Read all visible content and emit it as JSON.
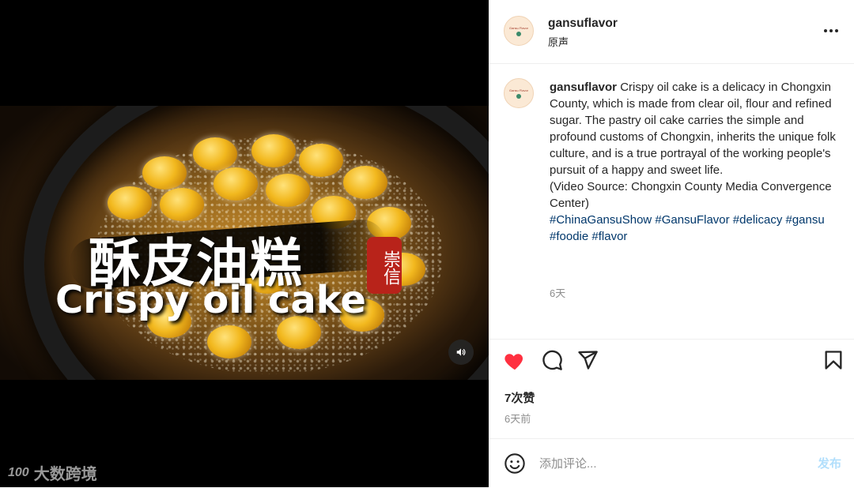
{
  "video": {
    "title_cn": "酥皮油糕",
    "seal_text": "崇信",
    "title_en": "Crispy oil cake",
    "audio_icon": "speaker-icon"
  },
  "watermark": {
    "text": "大数跨境",
    "logo_text": "100"
  },
  "header": {
    "username": "gansuflavor",
    "audio_label": "原声",
    "avatar_text": "Gansu Flavor",
    "more_icon": "more-dots-icon"
  },
  "caption": {
    "username": "gansuflavor",
    "text": "Crispy oil cake is a delicacy in Chongxin County, which is made from clear oil, flour and refined sugar. The pastry oil cake carries the simple and profound customs of Chongxin, inherits the unique folk culture, and is a true portrayal of the working people's pursuit of a happy and sweet life.\n(Video Source: Chongxin County Media Convergence Center)",
    "hashtags": "#ChinaGansuShow #GansuFlavor #delicacy #gansu #foodie #flavor",
    "time_ago": "6天"
  },
  "actions": {
    "like_icon": "heart-filled-icon",
    "comment_icon": "comment-icon",
    "share_icon": "send-icon",
    "save_icon": "bookmark-icon",
    "like_color": "#ff3040"
  },
  "likes": {
    "label": "7次赞"
  },
  "posted": {
    "label": "6天前"
  },
  "comment": {
    "placeholder": "添加评论...",
    "post_label": "发布",
    "emoji_icon": "emoji-icon"
  }
}
